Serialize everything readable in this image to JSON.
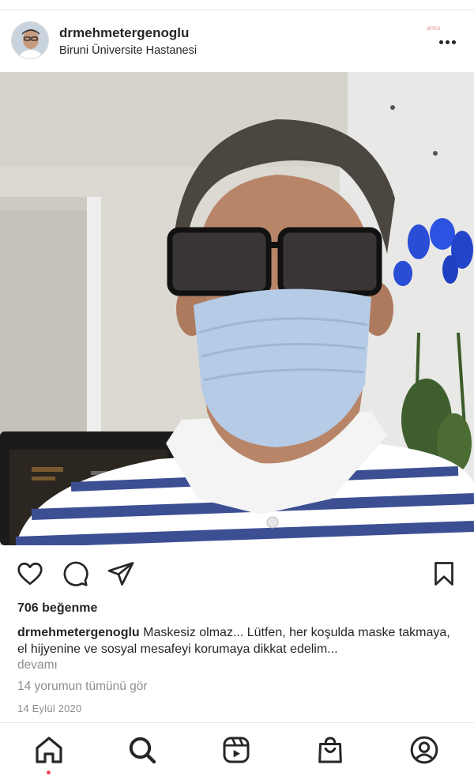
{
  "post": {
    "username": "drmehmetergenoglu",
    "location": "Biruni Üniversite Hastanesi",
    "watermark": "anka",
    "likes": "706 beğenme",
    "caption_text": "Maskesiz olmaz... Lütfen, her koşulda maske takmaya, el hijyenine ve sosyal mesafeyi korumaya dikkat edelim...",
    "more_label": "devamı",
    "view_comments": "14 yorumun tümünü gör",
    "date": "14 Eylül 2020"
  },
  "actions": {
    "icons": [
      "heart-icon",
      "comment-icon",
      "share-icon",
      "bookmark-icon"
    ]
  },
  "nav": {
    "items": [
      "home-icon",
      "search-icon",
      "reels-icon",
      "shop-icon",
      "profile-icon"
    ],
    "active": "home-icon"
  },
  "colors": {
    "text": "#262626",
    "secondary": "#8e8e8e",
    "divider": "#e6e6e6",
    "notification": "#ed4956"
  }
}
